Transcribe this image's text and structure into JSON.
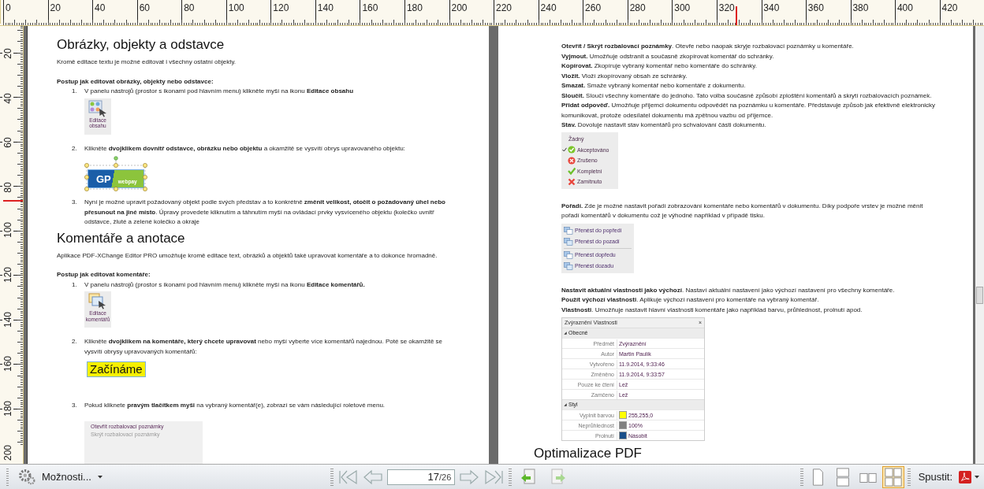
{
  "rulers": {
    "horizontal": [
      "0",
      "20",
      "40",
      "60",
      "80",
      "100",
      "120",
      "140",
      "160",
      "180",
      "200",
      "220",
      "240",
      "260",
      "280",
      "300",
      "320",
      "340",
      "360",
      "380",
      "400",
      "420"
    ],
    "vertical": [
      "20",
      "40",
      "60",
      "80",
      "100",
      "120",
      "140",
      "160",
      "180",
      "200"
    ]
  },
  "left_page": {
    "blocks": [
      {
        "kind": "heading",
        "text": "Obrázky, objekty a odstavce"
      },
      {
        "kind": "paragraph",
        "text": "Kromě editace textu je možné editovat i všechny ostatní objekty."
      },
      {
        "kind": "subheading",
        "text": "Postup jak editovat obrázky, objekty nebo odstavce:"
      },
      {
        "kind": "step",
        "number": "1.",
        "text": "V panelu nástrojů (prostor s ikonami pod hlavním menu) klikněte myší na ikonu **Editace obsahu**"
      },
      {
        "kind": "tool_icon",
        "lines": [
          "Editace",
          "obsahu"
        ]
      },
      {
        "kind": "step",
        "number": "2.",
        "text": "Klikněte **dvojklikem dovnitř odstavce, obrázku nebo objektu** a okamžitě se vysvítí obrys upravovaného objektu:"
      },
      {
        "kind": "logo",
        "text_1": "GP",
        "text_2": "webpay"
      },
      {
        "kind": "step",
        "number": "3.",
        "text": "Nyní je možné upravit požadovaný objekt podle svých představ a to konkrétně **změnit velikost, otočit o požadovaný úhel nebo přesunout na jiné místo**. Úpravy provedete kliknutím a táhnutím myší na ovládací prvky vysvíceného objektu (kolečko uvnitř odstavce, žluté a zelené kolečko a okraje"
      },
      {
        "kind": "heading",
        "text": "Komentáře a anotace"
      },
      {
        "kind": "paragraph",
        "text": "Aplikace PDF-XChange Editor PRO umožňuje kromě editace text, obrázků a objektů také upravovat komentáře a to dokonce hromadně."
      },
      {
        "kind": "subheading",
        "text": "Postup jak editovat komentáře:"
      },
      {
        "kind": "step",
        "number": "1.",
        "text": "V panelu nástrojů (prostor s ikonami pod hlavním menu) klikněte myší na ikonu **Editace komentářů.**"
      },
      {
        "kind": "tool_icon",
        "lines": [
          "Editace",
          "komentářů"
        ]
      },
      {
        "kind": "step",
        "number": "2.",
        "text": "Klikněte **dvojklikem na komentáře, který chcete upravovat** nebo myší vyberte více komentářů najednou. Poté se okamžitě se vysvítí obrysy upravovaných komentářů:"
      },
      {
        "kind": "highlight",
        "text": "Začínáme"
      },
      {
        "kind": "step",
        "number": "3.",
        "text": "Pokud kliknete **pravým tlačítkem myši** na vybraný komentář(e), zobrazí se vám následující roletové menu."
      },
      {
        "kind": "context_menu",
        "items": [
          {
            "label": "Otevřít rozbalovací poznámky",
            "disabled": false
          },
          {
            "label": "Skrýt rozbalovací poznámky",
            "disabled": true
          }
        ]
      }
    ]
  },
  "right_page": {
    "blocks": [
      {
        "kind": "definition",
        "text": "**Otevřít / Skrýt rozbalovací poznámky**. Otevře nebo naopak skryje rozbalovací poznámky u komentáře."
      },
      {
        "kind": "definition",
        "text": "**Vyjmout.** Umožňuje odstranit a současně zkopírovat komentář do schránky."
      },
      {
        "kind": "definition",
        "text": "**Kopírovat.** Zkopíruje vybraný komentář nebo komentáře do schránky."
      },
      {
        "kind": "definition",
        "text": "**Vložit.** Vloží zkopírovaný obsah ze schránky."
      },
      {
        "kind": "definition",
        "text": "**Smazat.** Smaže vybraný komentář nebo komentáře z dokumentu."
      },
      {
        "kind": "definition",
        "text": "**Sloučit.** Sloučí všechny komentáře do jednoho. Tato volba současně způsobí zploštění komentářů a skrytí rozbalovacích poznámek."
      },
      {
        "kind": "definition",
        "text": "**Přidat odpověď.** Umožňuje příjemci dokumentu odpovědět na poznámku u komentáře. Představuje způsob jak efektivně elektronicky komunikovat, protože odesílatel dokumentu má zpětnou vazbu od příjemce."
      },
      {
        "kind": "definition",
        "text": "**Stav.** Dovoluje nastavit stav komentářů pro schvalování části dokumentu."
      },
      {
        "kind": "status_menu",
        "items": [
          {
            "label": "Žádný",
            "kind": "none",
            "checked": false
          },
          {
            "label": "Akceptováno",
            "kind": "accepted",
            "checked": true
          },
          {
            "label": "Zrušeno",
            "kind": "cancelled",
            "checked": false
          },
          {
            "label": "Kompletní",
            "kind": "completed",
            "checked": false
          },
          {
            "label": "Zamítnuto",
            "kind": "rejected",
            "checked": false
          }
        ]
      },
      {
        "kind": "section_text",
        "text": "**Pořadí.** Zde je možné nastavit pořadí zobrazování komentáře nebo komentářů v dokumentu. Díky podpoře vrstev je možné měnit pořadí komentářů v dokumentu což je výhodné například v případě tisku."
      },
      {
        "kind": "order_menu",
        "groups": [
          [
            "Přenést do popředí",
            "Přenést do pozadí"
          ],
          [
            "Přenést dopředu",
            "Přenést dozadu"
          ]
        ]
      },
      {
        "kind": "section_text",
        "text": "**Nastavit aktuální vlastnosti jako výchozí**. Nastaví aktuální nastavení jako výchozí nastavení pro všechny komentáře."
      },
      {
        "kind": "definition",
        "text": "**Použít výchozí vlastnosti**. Aplikuje výchozí nastavení pro komentáře na vybraný komentář."
      },
      {
        "kind": "definition",
        "text": "**Vlastnosti**. Umožňuje nastavit hlavní vlastnosti komentáře jako například barvu, průhlednost, prolnutí apod."
      },
      {
        "kind": "properties",
        "title": "Zvýraznění Vlastnosti",
        "close": "×",
        "sections": [
          {
            "label": "Obecné",
            "expanded": true,
            "rows": [
              {
                "name": "Předmět",
                "value": "Zvýraznění"
              },
              {
                "name": "Autor",
                "value": "Martin Paulík"
              },
              {
                "name": "Vytvořeno",
                "value": "11.9.2014, 9:33:46"
              },
              {
                "name": "Změněno",
                "value": "11.9.2014, 9:33:57"
              },
              {
                "name": "Pouze ke čtení",
                "value": "Lež"
              },
              {
                "name": "Zamčeno",
                "value": "Lež"
              }
            ]
          },
          {
            "label": "Styl",
            "expanded": true,
            "rows": [
              {
                "name": "Vyplnit barvou",
                "value": "255,255,0",
                "color": "#ffff00"
              },
              {
                "name": "Neprůhlednost",
                "value": "100%",
                "color": "#808080"
              },
              {
                "name": "Prolnutí",
                "value": "Násobit",
                "color": "#1a4f8a"
              }
            ]
          }
        ]
      },
      {
        "kind": "heading",
        "text": "Optimalizace PDF"
      }
    ]
  },
  "toolbar": {
    "options_label": "Možnosti...",
    "page": "17",
    "total_label": "/26",
    "layouts": [
      {
        "kind": "single",
        "selected": false
      },
      {
        "kind": "continuous",
        "selected": false
      },
      {
        "kind": "facing",
        "selected": false
      },
      {
        "kind": "facing_continuous",
        "selected": true
      }
    ],
    "run_label": "Spustit:"
  }
}
